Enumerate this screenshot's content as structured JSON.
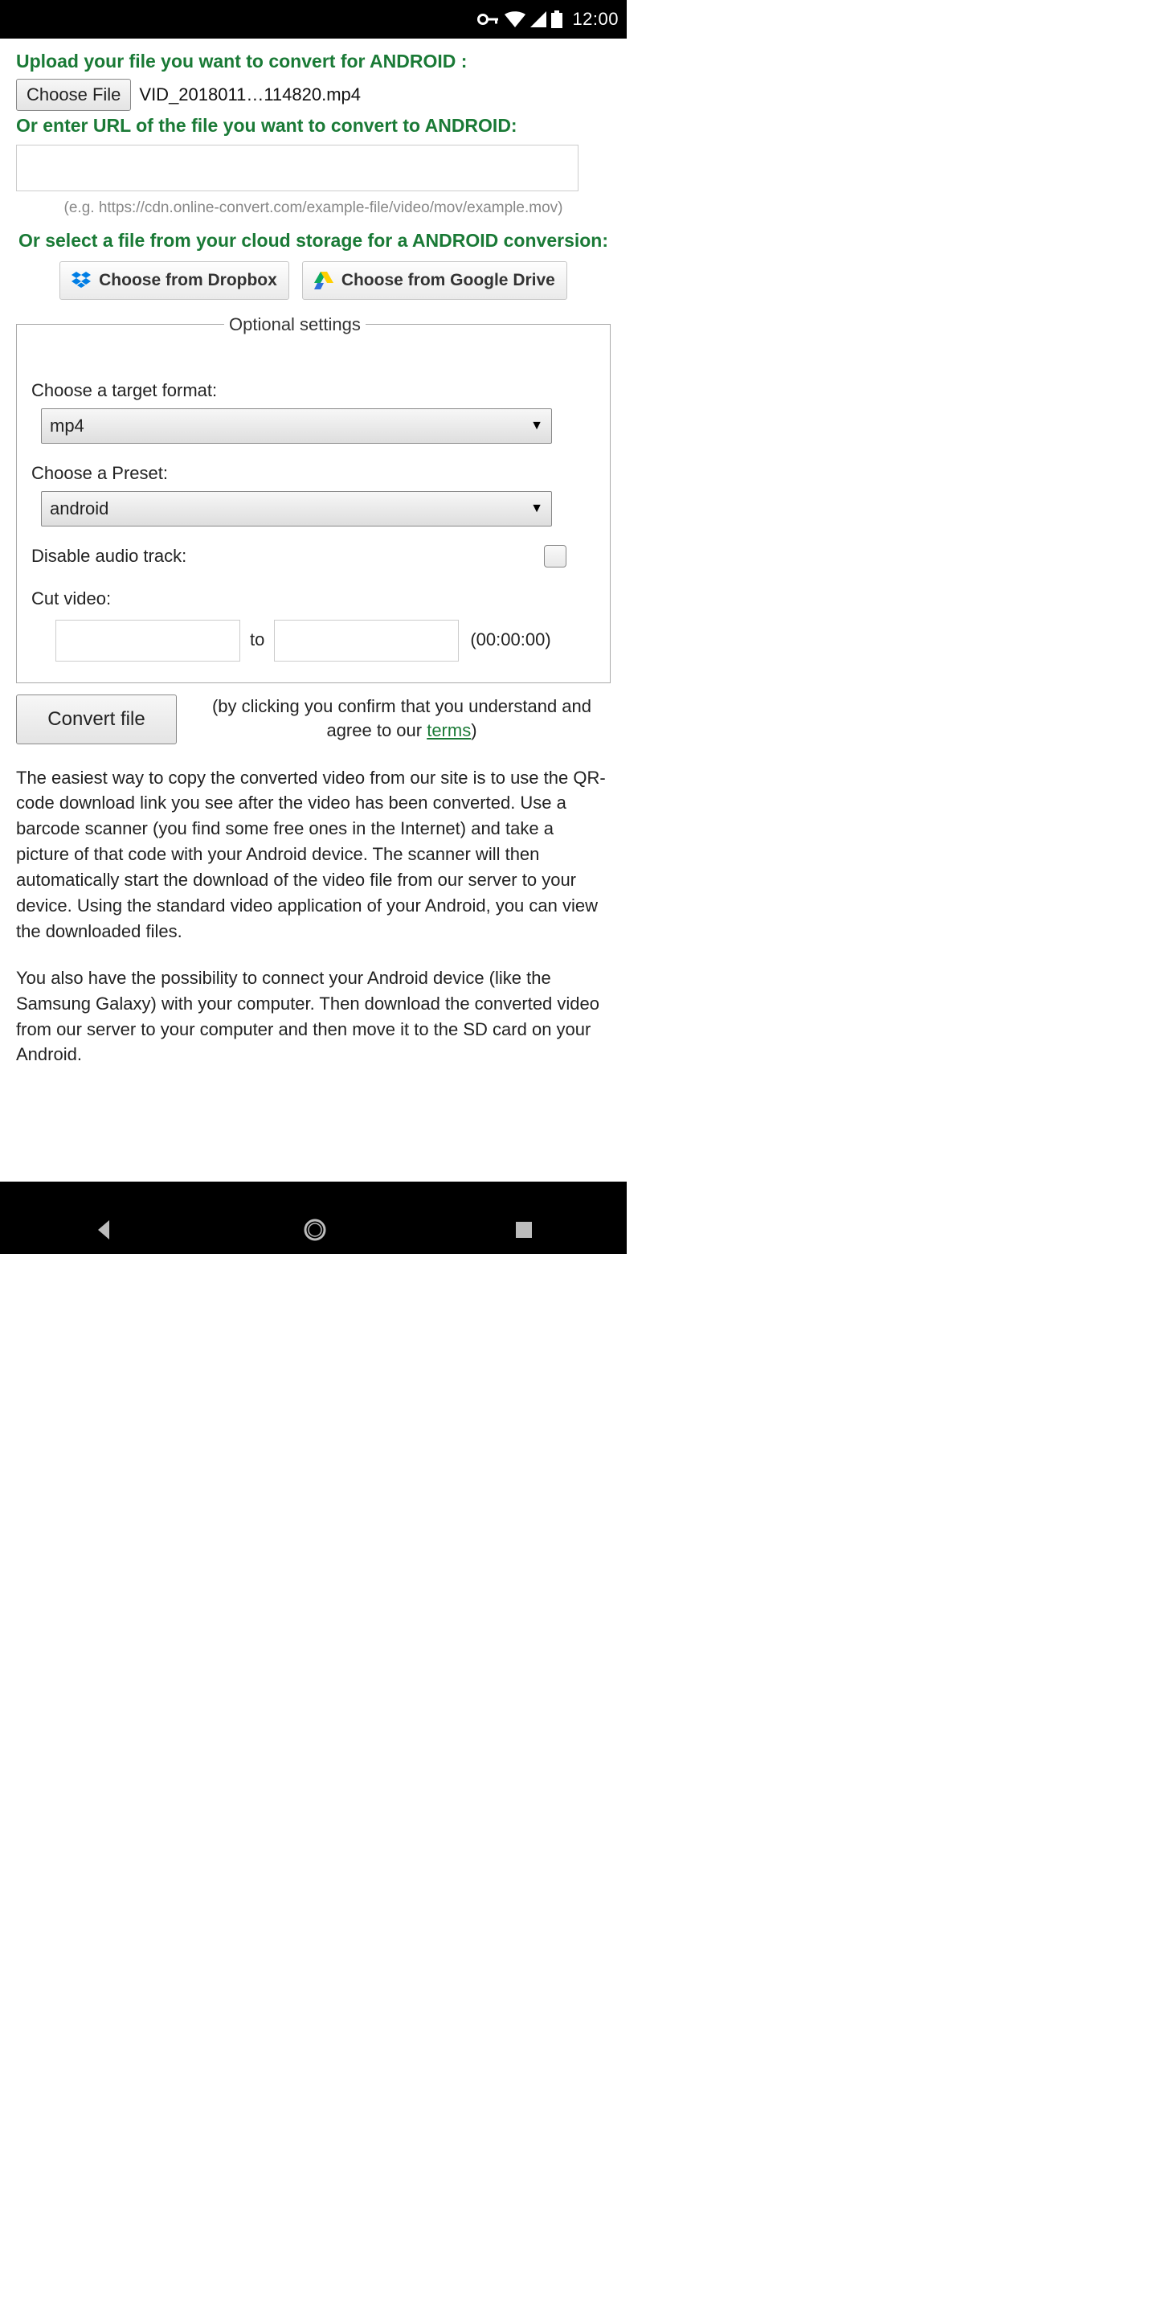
{
  "statusbar": {
    "time": "12:00"
  },
  "headings": {
    "upload": "Upload your file you want to convert for ANDROID :",
    "url": "Or enter URL of the file you want to convert to ANDROID:",
    "cloud": "Or select a file from your cloud storage for a ANDROID conversion:"
  },
  "file": {
    "choose_label": "Choose File",
    "selected_name": "VID_2018011…114820.mp4"
  },
  "url_hint": "(e.g. https://cdn.online-convert.com/example-file/video/mov/example.mov)",
  "cloud": {
    "dropbox_label": "Choose from Dropbox",
    "gdrive_label": "Choose from Google Drive"
  },
  "optional": {
    "legend": "Optional settings",
    "target_label": "Choose a target format:",
    "target_value": "mp4",
    "preset_label": "Choose a Preset:",
    "preset_value": "android",
    "disable_audio_label": "Disable audio track:",
    "cut_label": "Cut video:",
    "cut_to": "to",
    "cut_hint": "(00:00:00)"
  },
  "convert": {
    "button_label": "Convert file",
    "disclaimer_prefix": "(by clicking you confirm that you understand and agree to our ",
    "terms_label": "terms",
    "disclaimer_suffix": ")"
  },
  "para1": "The easiest way to copy the converted video from our site is to use the QR-code download link you see after the video has been converted. Use a barcode scanner (you find some free ones in the Internet) and take a picture of that code with your Android device. The scanner will then automatically start the download of the video file from our server to your device. Using the standard video application of your Android, you can view the downloaded files.",
  "para2": "You also have the possibility to connect your Android device (like the Samsung Galaxy) with your computer. Then download the converted video from our server to your computer and then move it to the SD card on your Android."
}
